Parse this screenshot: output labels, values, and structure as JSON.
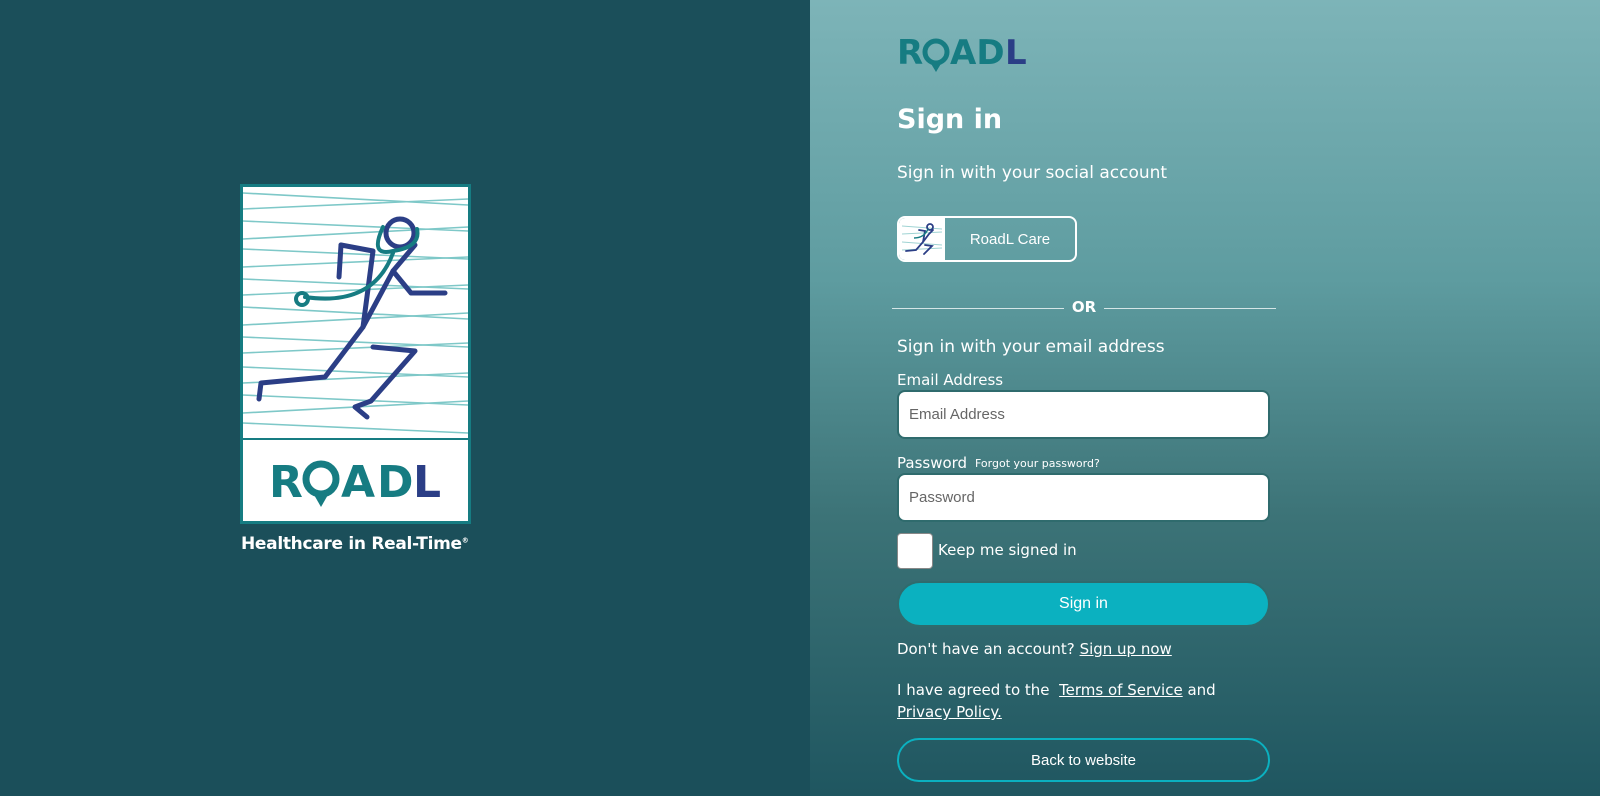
{
  "brand": {
    "name": "ROADL",
    "tagline": "Healthcare in Real-Time",
    "tagline_mark": "®",
    "colors": {
      "teal": "#167c82",
      "navy": "#2b3e86",
      "accent": "#0bb1c0",
      "background": "#1b4f5a"
    }
  },
  "form": {
    "title": "Sign in",
    "social_heading": "Sign in with your social account",
    "social_button_label": "RoadL Care",
    "divider_text": "OR",
    "email_heading": "Sign in with your email address",
    "email_label": "Email Address",
    "email_placeholder": "Email Address",
    "email_value": "",
    "password_label": "Password",
    "forgot_link": "Forgot your password?",
    "password_placeholder": "Password",
    "password_value": "",
    "keep_signed_in_label": "Keep me signed in",
    "keep_signed_in_checked": false,
    "submit_label": "Sign in",
    "no_account_text": "Don't have an account?",
    "sign_up_link": "Sign up now",
    "terms_prefix": "I have agreed to the",
    "terms_link": "Terms of Service",
    "terms_and": "and",
    "privacy_link": "Privacy Policy.",
    "back_button": "Back to website"
  }
}
